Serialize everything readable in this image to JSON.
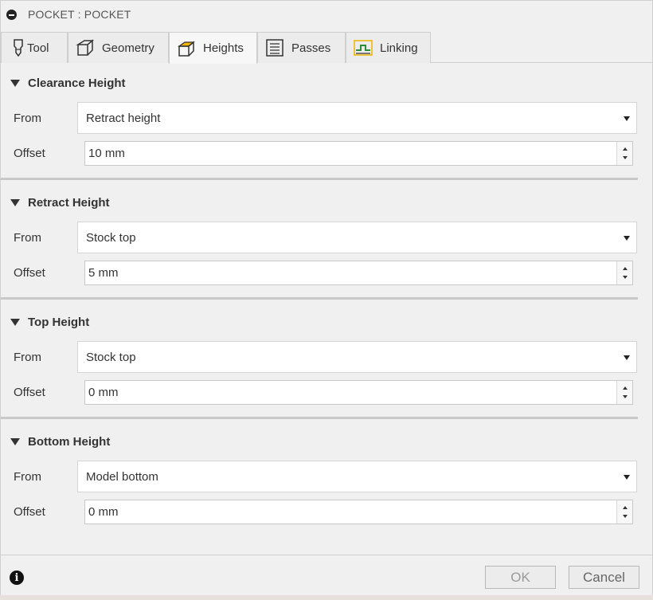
{
  "window": {
    "title": "POCKET : POCKET"
  },
  "tabs": [
    {
      "label": "Tool",
      "icon": "tool-icon",
      "active": false
    },
    {
      "label": "Geometry",
      "icon": "geometry-icon",
      "active": false
    },
    {
      "label": "Heights",
      "icon": "heights-icon",
      "active": true
    },
    {
      "label": "Passes",
      "icon": "passes-icon",
      "active": false
    },
    {
      "label": "Linking",
      "icon": "linking-icon",
      "active": false
    }
  ],
  "sections": [
    {
      "title": "Clearance Height",
      "from_label": "From",
      "from_value": "Retract height",
      "offset_label": "Offset",
      "offset_value": "10 mm"
    },
    {
      "title": "Retract Height",
      "from_label": "From",
      "from_value": "Stock top",
      "offset_label": "Offset",
      "offset_value": "5 mm"
    },
    {
      "title": "Top Height",
      "from_label": "From",
      "from_value": "Stock top",
      "offset_label": "Offset",
      "offset_value": "0 mm"
    },
    {
      "title": "Bottom Height",
      "from_label": "From",
      "from_value": "Model bottom",
      "offset_label": "Offset",
      "offset_value": "0 mm"
    }
  ],
  "footer": {
    "ok_label": "OK",
    "cancel_label": "Cancel",
    "info_glyph": "i"
  },
  "colors": {
    "dialog_bg": "#f0f0f0",
    "accent_yellow": "#f0b400",
    "accent_green": "#2e8b3a"
  }
}
